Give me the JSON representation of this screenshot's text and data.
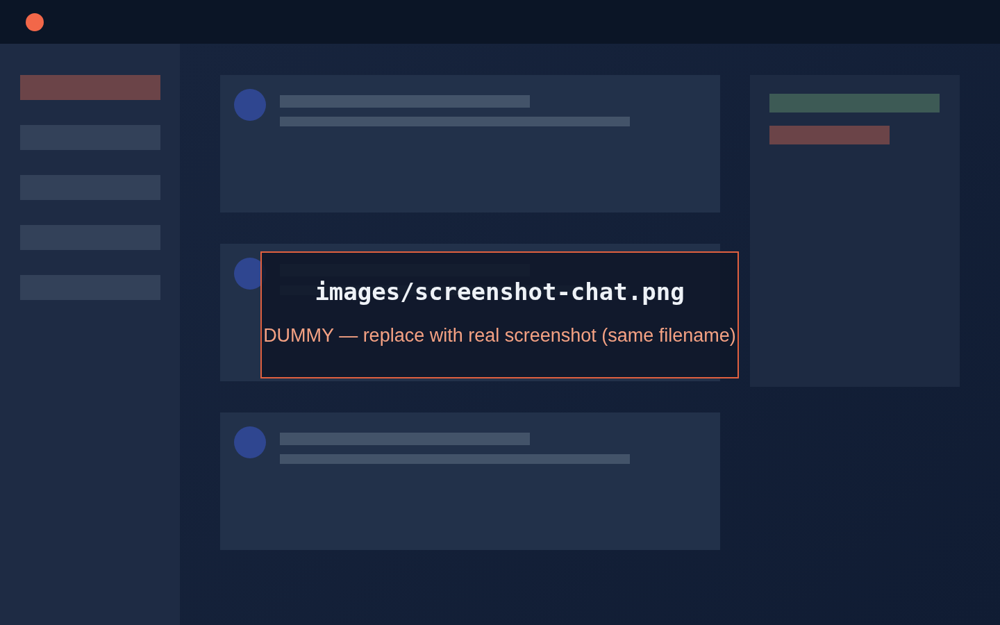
{
  "window": {
    "status_dot": {
      "color": "#f26749"
    }
  },
  "sidebar": {
    "items": [
      {
        "selected": true
      },
      {
        "selected": false
      },
      {
        "selected": false
      },
      {
        "selected": false
      },
      {
        "selected": false
      }
    ]
  },
  "messages": [
    {
      "kind": "message"
    },
    {
      "kind": "message"
    },
    {
      "kind": "message"
    }
  ],
  "side_panel": {
    "tags": [
      {
        "color": "#3d5a55",
        "kind": "long"
      },
      {
        "color": "#6b4448",
        "kind": "short"
      }
    ]
  },
  "overlay": {
    "title": "images/screenshot-chat.png",
    "note": "DUMMY — replace with real screenshot (same filename)"
  }
}
